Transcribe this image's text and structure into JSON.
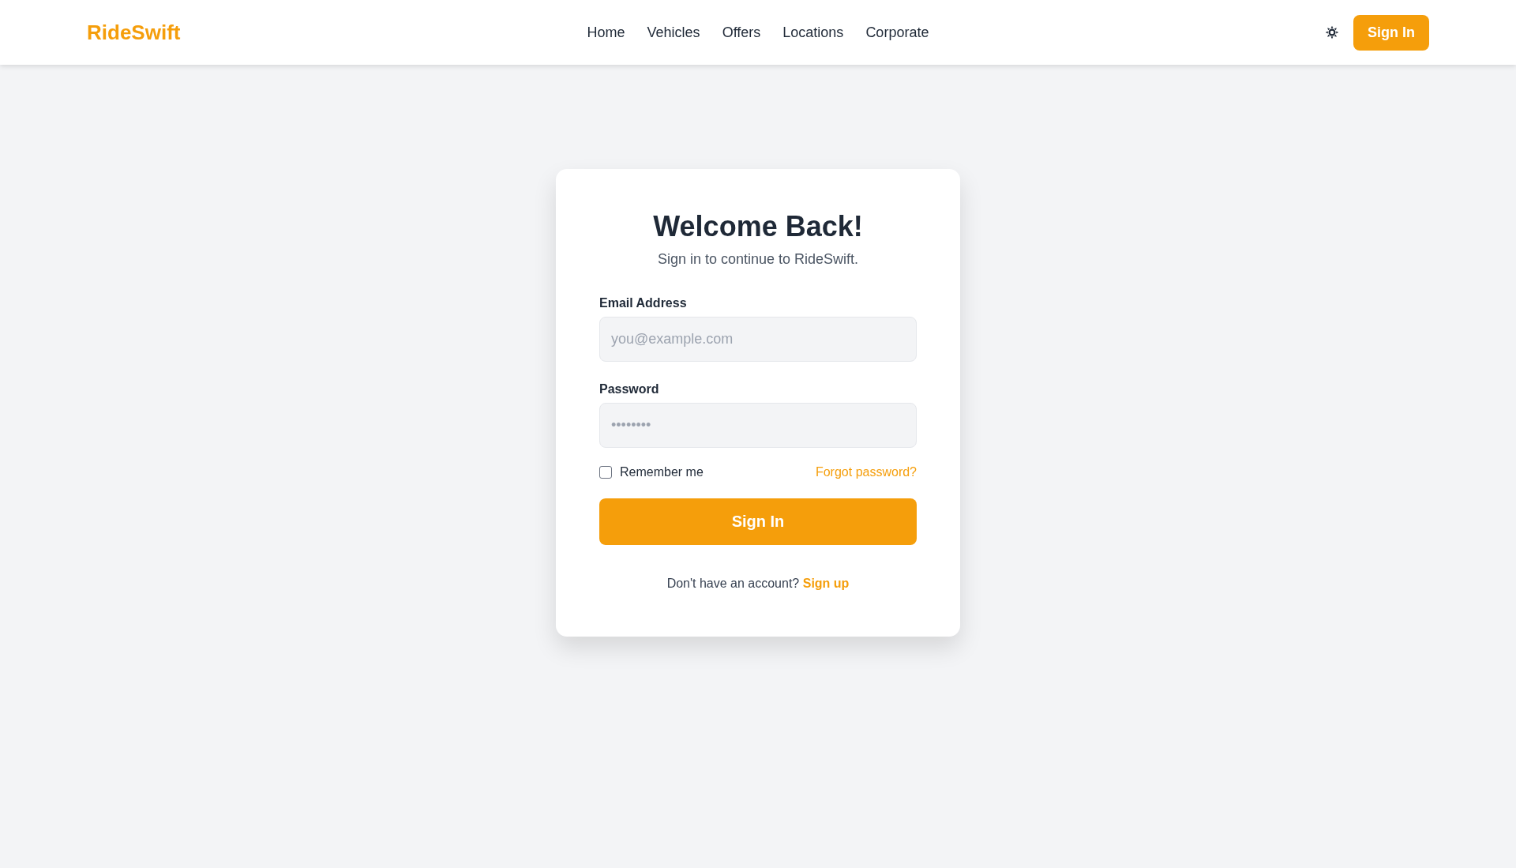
{
  "header": {
    "logo": "RideSwift",
    "nav": [
      {
        "label": "Home"
      },
      {
        "label": "Vehicles"
      },
      {
        "label": "Offers"
      },
      {
        "label": "Locations"
      },
      {
        "label": "Corporate"
      }
    ],
    "sign_in_button": "Sign In"
  },
  "login_card": {
    "title": "Welcome Back!",
    "subtitle": "Sign in to continue to RideSwift.",
    "fields": [
      {
        "label": "Email Address",
        "placeholder": "you@example.com"
      },
      {
        "label": "Password",
        "placeholder": "••••••••"
      }
    ],
    "remember_me": {
      "label": "Remember me",
      "checked": false
    },
    "forgot_link": "Forgot password?",
    "submit_button": "Sign In",
    "footer": {
      "text": "Don't have an account?",
      "link": "Sign up"
    }
  }
}
